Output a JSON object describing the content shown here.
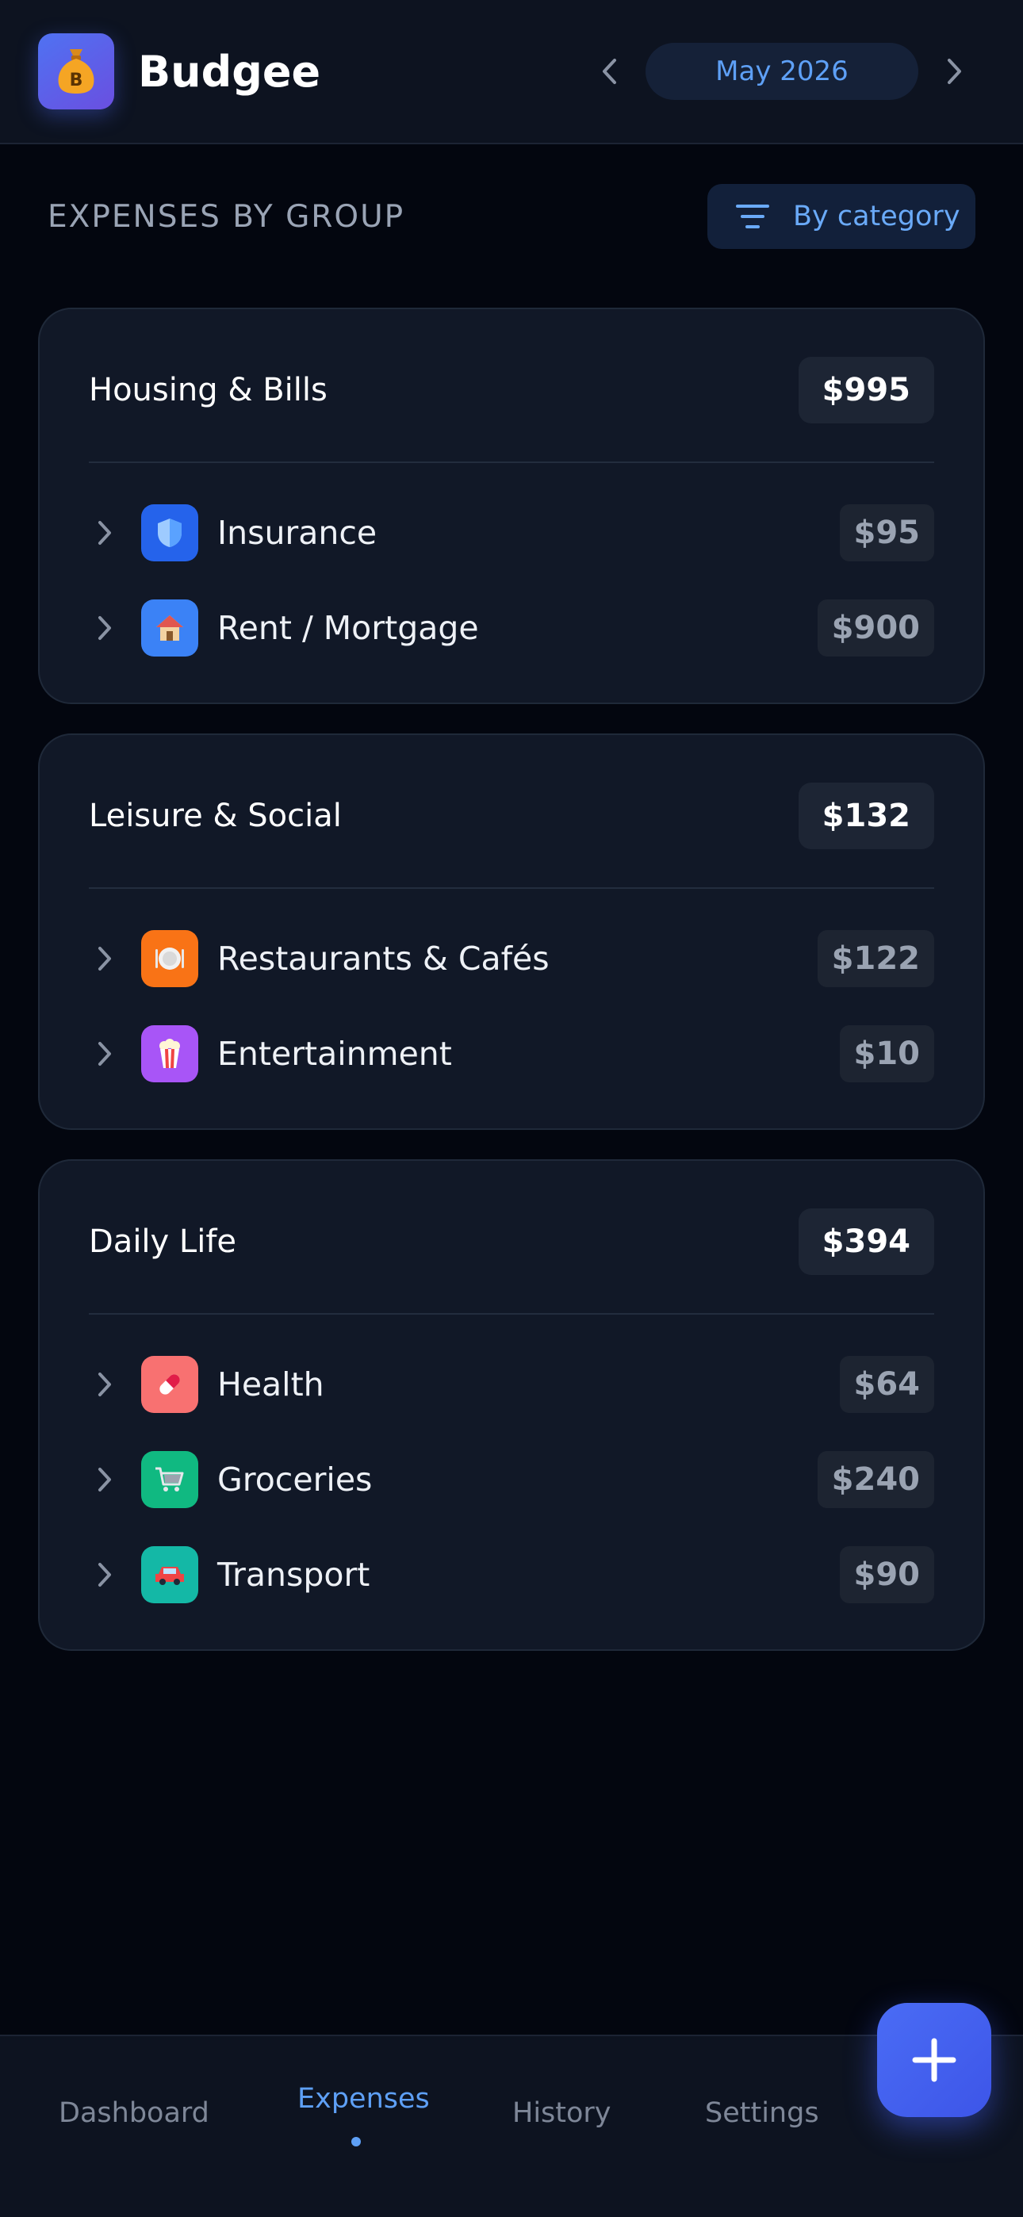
{
  "header": {
    "app_name": "Budgee",
    "month": "May 2026",
    "logo_icon": "money-bag-icon"
  },
  "section": {
    "title": "EXPENSES BY GROUP",
    "view_toggle_label": "By category"
  },
  "groups": [
    {
      "name": "Housing & Bills",
      "total": "$995",
      "categories": [
        {
          "name": "Insurance",
          "amount": "$95",
          "icon": "shield-icon",
          "color": "#2563eb"
        },
        {
          "name": "Rent / Mortgage",
          "amount": "$900",
          "icon": "house-icon",
          "color": "#3b82f6"
        }
      ]
    },
    {
      "name": "Leisure & Social",
      "total": "$132",
      "categories": [
        {
          "name": "Restaurants & Cafés",
          "amount": "$122",
          "icon": "plate-icon",
          "color": "#f97316"
        },
        {
          "name": "Entertainment",
          "amount": "$10",
          "icon": "popcorn-icon",
          "color": "#a855f7"
        }
      ]
    },
    {
      "name": "Daily Life",
      "total": "$394",
      "categories": [
        {
          "name": "Health",
          "amount": "$64",
          "icon": "pill-icon",
          "color": "#f87171"
        },
        {
          "name": "Groceries",
          "amount": "$240",
          "icon": "cart-icon",
          "color": "#10b981"
        },
        {
          "name": "Transport",
          "amount": "$90",
          "icon": "car-icon",
          "color": "#14b8a6"
        }
      ]
    }
  ],
  "nav": {
    "dashboard": "Dashboard",
    "expenses": "Expenses",
    "history": "History",
    "settings": "Settings",
    "active": "Expenses"
  },
  "colors": {
    "accent": "#5ea0f6",
    "fab": "#4a6cf5",
    "background": "#03060f",
    "card": "#111827"
  }
}
